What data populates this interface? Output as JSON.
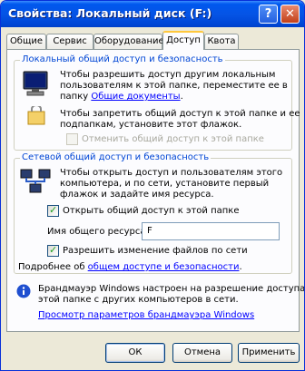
{
  "window": {
    "title": "Свойства: Локальный диск (F:)"
  },
  "titlebar": {
    "help_label": "?",
    "close_label": "✕"
  },
  "tabs": [
    {
      "label": "Общие"
    },
    {
      "label": "Сервис"
    },
    {
      "label": "Оборудование"
    },
    {
      "label": "Доступ"
    },
    {
      "label": "Квота"
    }
  ],
  "local": {
    "title": "Локальный общий доступ и безопасность",
    "line1": "Чтобы разрешить доступ другим локальным",
    "line2": "пользователям к этой папке, переместите ее в",
    "line3_prefix": "папку ",
    "line3_link": "Общие документы",
    "line3_suffix": ".",
    "line4": "Чтобы запретить общий доступ к этой папке и ее",
    "line5": "подпапкам, установите этот флажок.",
    "checkbox_label": "Отменить общий доступ к этой папке"
  },
  "network": {
    "title": "Сетевой общий доступ и безопасность",
    "line1": "Чтобы открыть доступ и пользователям этого",
    "line2": "компьютера, и по сети, установите первый",
    "line3": "флажок и задайте имя ресурса.",
    "share_checkbox_label": "Открыть общий доступ к этой папке",
    "share_name_label": "Имя общего ресурса:",
    "share_name_value": "F",
    "allow_edit_label": "Разрешить изменение файлов по сети",
    "more_prefix": "Подробнее об ",
    "more_link": "общем доступе и безопасности",
    "more_suffix": "."
  },
  "firewall": {
    "line1": "Брандмауэр Windows настроен на разрешение доступа к",
    "line2": "этой папке с других компьютеров в сети.",
    "link": "Просмотр параметров брандмауэра Windows"
  },
  "buttons": {
    "ok": "ОК",
    "cancel": "Отмена",
    "apply": "Применить"
  }
}
